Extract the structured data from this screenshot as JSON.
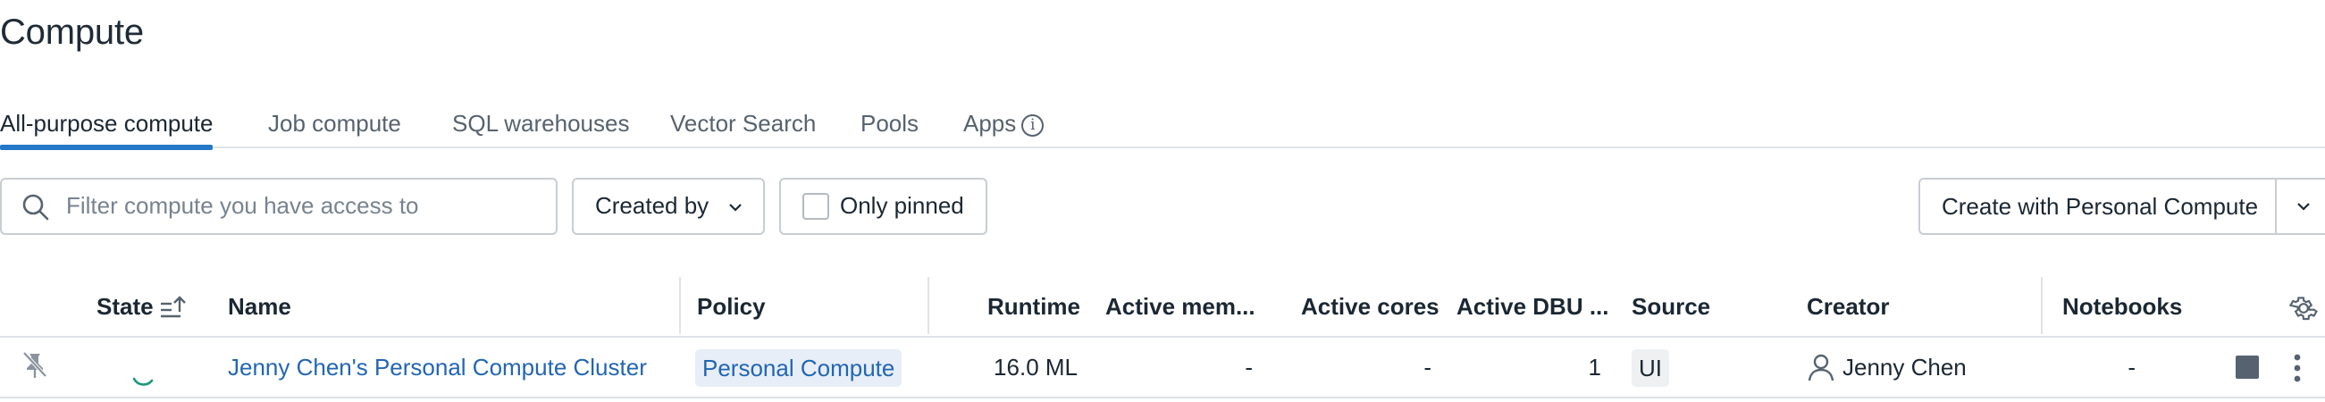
{
  "page": {
    "title": "Compute"
  },
  "tabs": [
    {
      "label": "All-purpose compute"
    },
    {
      "label": "Job compute"
    },
    {
      "label": "SQL warehouses"
    },
    {
      "label": "Vector Search"
    },
    {
      "label": "Pools"
    },
    {
      "label": "Apps"
    }
  ],
  "filters": {
    "search_placeholder": "Filter compute you have access to",
    "created_by_label": "Created by",
    "only_pinned_label": "Only pinned"
  },
  "actions": {
    "create_label": "Create with Personal Compute"
  },
  "table": {
    "headers": {
      "state": "State",
      "name": "Name",
      "policy": "Policy",
      "runtime": "Runtime",
      "active_memory": "Active mem...",
      "active_cores": "Active cores",
      "active_dbu": "Active DBU ...",
      "source": "Source",
      "creator": "Creator",
      "notebooks": "Notebooks"
    },
    "rows": [
      {
        "name": "Jenny Chen's Personal Compute Cluster",
        "policy": "Personal Compute",
        "runtime": "16.0 ML",
        "active_memory": "-",
        "active_cores": "-",
        "active_dbu": "1",
        "source": "UI",
        "creator": "Jenny Chen",
        "notebooks": "-"
      }
    ]
  },
  "colors": {
    "accent": "#2478c7",
    "link": "#2266b3",
    "border": "#c8cdd3"
  },
  "icons": [
    "info-icon",
    "search-icon",
    "chevron-down-icon",
    "sort-ascending-icon",
    "gear-icon",
    "pin-off-icon",
    "spinner-icon",
    "user-icon",
    "stop-icon",
    "kebab-menu-icon"
  ]
}
